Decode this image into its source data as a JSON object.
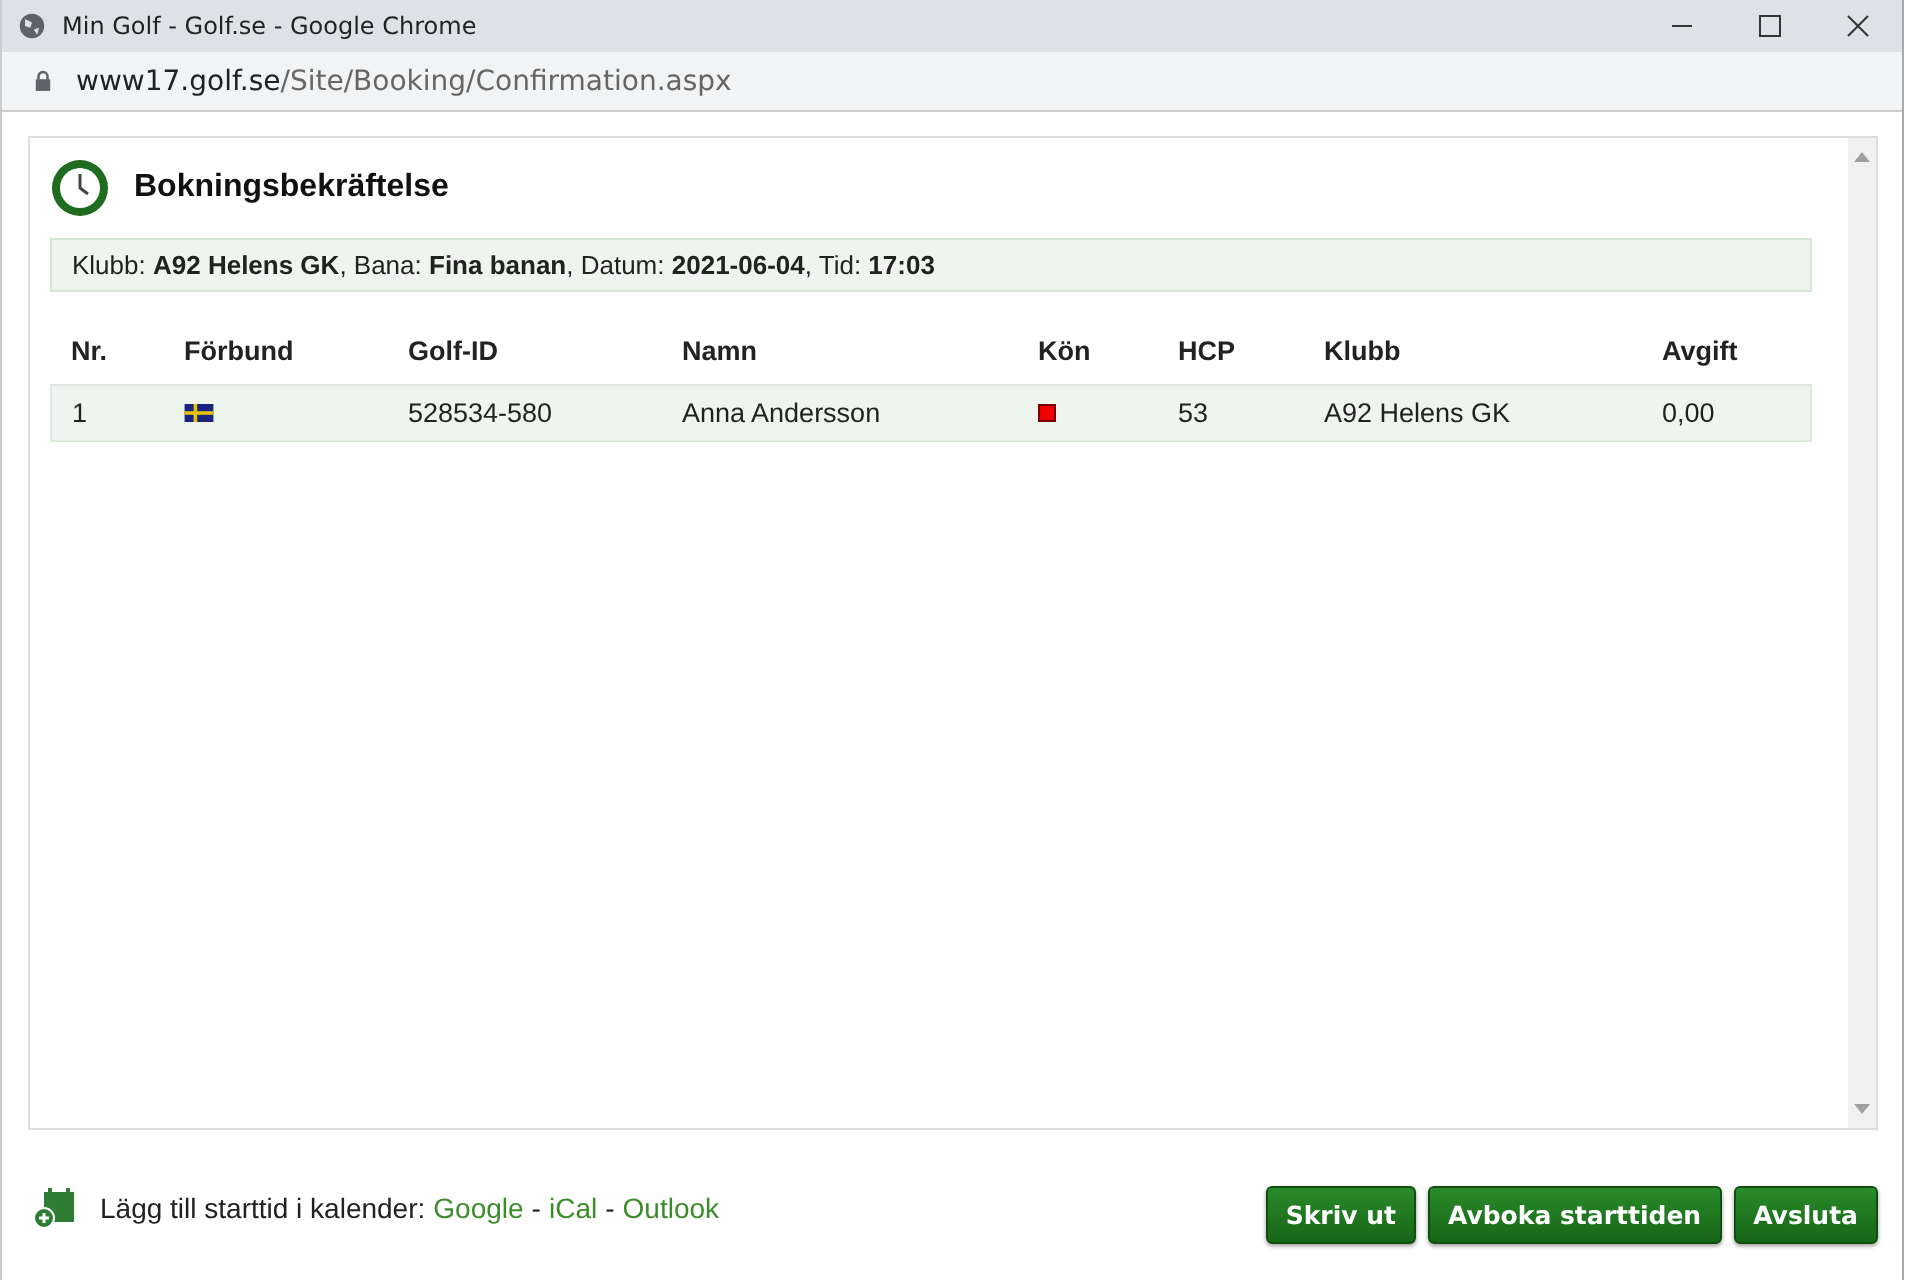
{
  "window": {
    "title": "Min Golf - Golf.se - Google Chrome"
  },
  "address_bar": {
    "host": "www17.golf.se",
    "path": "/Site/Booking/Confirmation.aspx"
  },
  "heading": "Bokningsbekräftelse",
  "booking_info": "Klubb: **A92 Helens GK**, Bana: **Fina banan**, Datum: **2021-06-04**, Tid: **17:03**",
  "table": {
    "columns": [
      "Nr.",
      "Förbund",
      "Golf-ID",
      "Namn",
      "Kön",
      "HCP",
      "Klubb",
      "Avgift"
    ],
    "rows": [
      {
        "nr": "1",
        "golf_id": "528534-580",
        "name": "Anna Andersson",
        "hcp": "53",
        "club": "A92 Helens GK",
        "fee": "0,00"
      }
    ]
  },
  "calendar": {
    "label": "Lägg till starttid i kalender:",
    "items": [
      {
        "kind": "link",
        "text": "Google"
      },
      {
        "kind": "separator",
        "text": "-"
      },
      {
        "kind": "link",
        "text": "iCal"
      },
      {
        "kind": "separator",
        "text": "-"
      },
      {
        "kind": "link",
        "text": "Outlook"
      }
    ]
  },
  "buttons": [
    "Skriv ut",
    "Avboka starttiden",
    "Avsluta"
  ]
}
